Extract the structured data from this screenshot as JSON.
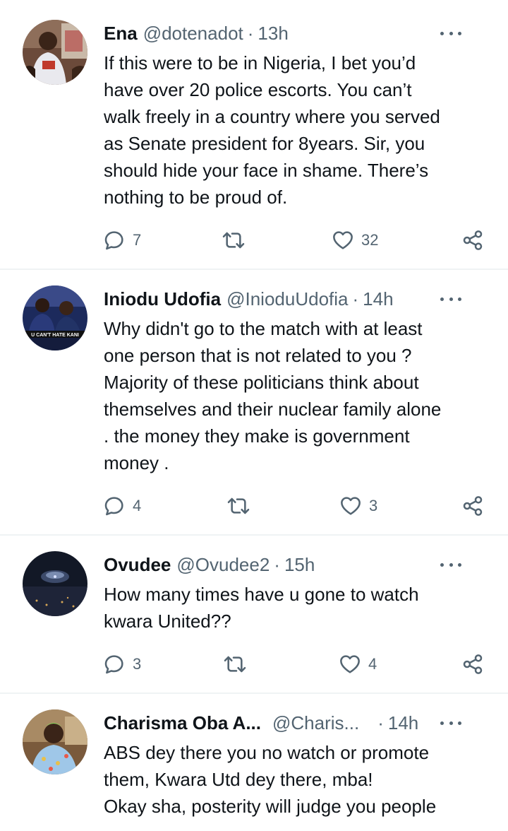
{
  "icons": {
    "reply": "reply-icon",
    "retweet": "retweet-icon",
    "like": "like-icon",
    "share": "share-icon",
    "more": "more-options-icon"
  },
  "colors": {
    "text": "#0f1419",
    "secondary": "#536471",
    "divider": "#eff3f4"
  },
  "tweets": [
    {
      "name": "Ena",
      "handle": "@dotenadot",
      "separator": "·",
      "time": "13h",
      "lines": [
        "If this were to be in Nigeria, I bet you’d",
        "have over 20 police escorts. You can’t",
        "walk freely in a country where you served",
        "as Senate president for 8years. Sir, you",
        "should hide your face in shame. There’s",
        "nothing to be proud of."
      ],
      "replies": "7",
      "retweets": "",
      "likes": "32"
    },
    {
      "name": "Iniodu Udofia",
      "handle": "@InioduUdofia",
      "separator": "·",
      "time": "14h",
      "avatar_text": "U CAN'T HATE KANI",
      "lines": [
        "Why didn't go to the match with at least",
        "one person that is not related to you ?",
        "Majority of these politicians think about",
        "themselves and their nuclear family alone",
        ". the money they make is government",
        "money ."
      ],
      "replies": "4",
      "retweets": "",
      "likes": "3"
    },
    {
      "name": "Ovudee",
      "handle": "@Ovudee2",
      "separator": "·",
      "time": "15h",
      "lines": [
        "How many times have u gone to watch",
        "kwara United??"
      ],
      "replies": "3",
      "retweets": "",
      "likes": "4"
    },
    {
      "name": "Charisma Oba A...",
      "handle": "@Charis...",
      "separator": "·",
      "time": "14h",
      "lines": [
        "ABS dey there you no watch or promote",
        "them, Kwara Utd dey there, mba!",
        "Okay sha, posterity will judge you people"
      ]
    }
  ]
}
